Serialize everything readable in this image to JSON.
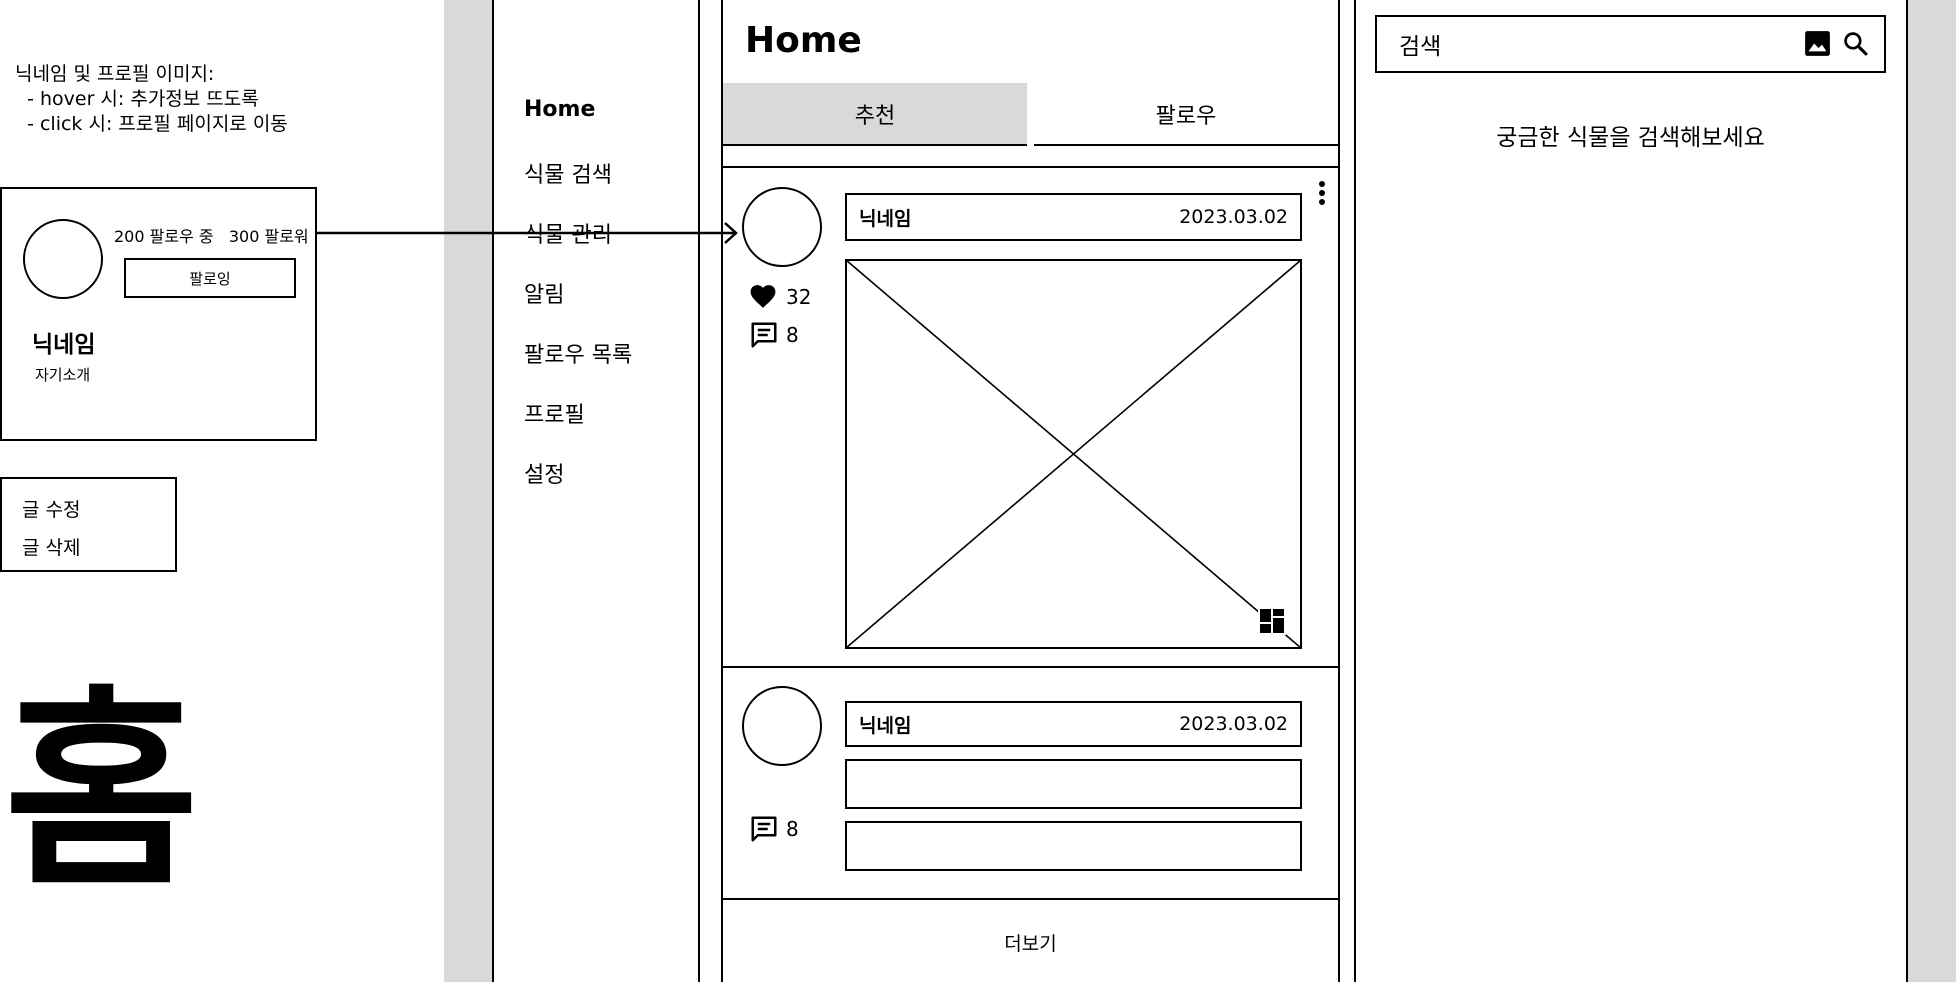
{
  "annotation": {
    "lines": [
      "닉네임 및 프로필 이미지:",
      "  - hover 시: 추가정보 뜨도록",
      "  - click 시: 프로필 페이지로 이동"
    ]
  },
  "profile_card": {
    "stats": "200 팔로우 중   300 팔로워",
    "follow_button": "팔로잉",
    "nickname": "닉네임",
    "bio": "자기소개"
  },
  "post_menu": {
    "items": [
      "글 수정",
      "글 삭제"
    ]
  },
  "page_label": "홈",
  "nav": {
    "items": [
      "Home",
      "식물 검색",
      "식물 관리",
      "알림",
      "팔로우 목록",
      "프로필",
      "설정"
    ]
  },
  "feed": {
    "title": "Home",
    "tabs": [
      "추천",
      "팔로우"
    ],
    "posts": [
      {
        "nickname": "닉네임",
        "date": "2023.03.02",
        "likes": "32",
        "comments": "8"
      },
      {
        "nickname": "닉네임",
        "date": "2023.03.02",
        "comments": "8"
      }
    ],
    "more_label": "더보기"
  },
  "search": {
    "placeholder": "검색",
    "hint": "궁금한 식물을 검색해보세요"
  },
  "colors": {
    "panel_gray": "#d9d9d9",
    "line": "#000000",
    "background": "#ffffff"
  },
  "icons": [
    "heart-icon",
    "comment-icon",
    "more-vertical-icon",
    "image-icon",
    "search-icon",
    "gallery-grid-icon",
    "arrow-right-icon"
  ]
}
